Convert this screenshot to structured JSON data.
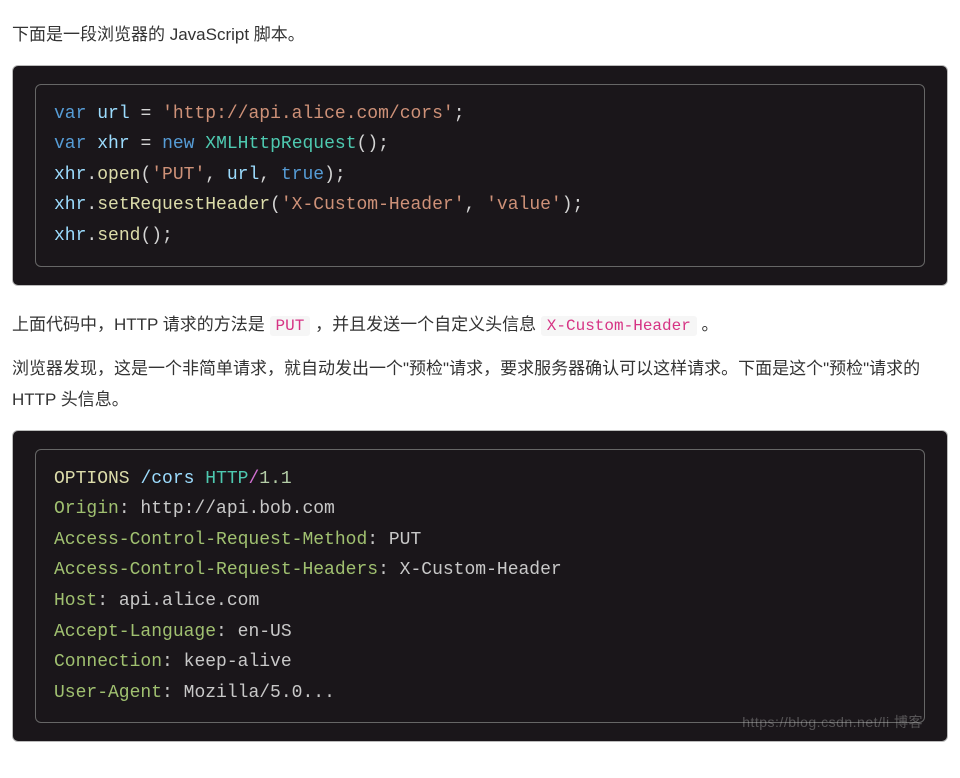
{
  "intro": "下面是一段浏览器的 JavaScript 脚本。",
  "code1": {
    "l1": {
      "kw": "var",
      "v": "url",
      "eq": "=",
      "s": "'http://api.alice.com/cors'",
      "semi": ";"
    },
    "l2": {
      "kw": "var",
      "v": "xhr",
      "eq": "=",
      "new": "new",
      "type": "XMLHttpRequest",
      "paren": "();"
    },
    "l3": {
      "obj": "xhr",
      "dot": ".",
      "fn": "open",
      "lp": "(",
      "a1": "'PUT'",
      "c1": ", ",
      "a2": "url",
      "c2": ", ",
      "a3": "true",
      "rp": ");"
    },
    "l4": {
      "obj": "xhr",
      "dot": ".",
      "fn": "setRequestHeader",
      "lp": "(",
      "a1": "'X-Custom-Header'",
      "c1": ", ",
      "a2": "'value'",
      "rp": ");"
    },
    "l5": {
      "obj": "xhr",
      "dot": ".",
      "fn": "send",
      "paren": "();"
    }
  },
  "mid": {
    "pre": "上面代码中，HTTP 请求的方法是 ",
    "put": "PUT",
    "mid": " ，并且发送一个自定义头信息 ",
    "hdr": "X-Custom-Header",
    "post": " 。"
  },
  "explain": "浏览器发现，这是一个非简单请求，就自动发出一个\"预检\"请求，要求服务器确认可以这样请求。下面是这个\"预检\"请求的 HTTP 头信息。",
  "http": {
    "req": {
      "method": "OPTIONS",
      "sp": " ",
      "path": "/cors",
      "sp2": " ",
      "proto": "HTTP",
      "slash": "/",
      "ver": "1.1"
    },
    "h1": {
      "n": "Origin",
      "c": ": ",
      "v": "http://api.bob.com"
    },
    "h2": {
      "n": "Access-Control-Request-Method",
      "c": ": ",
      "v": "PUT"
    },
    "h3": {
      "n": "Access-Control-Request-Headers",
      "c": ": ",
      "v": "X-Custom-Header"
    },
    "h4": {
      "n": "Host",
      "c": ": ",
      "v": "api.alice.com"
    },
    "h5": {
      "n": "Accept-Language",
      "c": ": ",
      "v": "en-US"
    },
    "h6": {
      "n": "Connection",
      "c": ": ",
      "v": "keep-alive"
    },
    "h7": {
      "n": "User-Agent",
      "c": ": ",
      "v": "Mozilla/5.0..."
    }
  },
  "watermark": "https://blog.csdn.net/li  博客"
}
